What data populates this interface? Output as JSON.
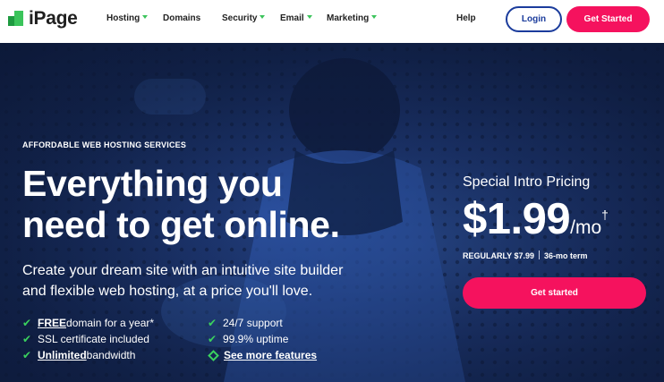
{
  "brand": {
    "name": "iPage",
    "accent": "#f5125e",
    "nav_blue": "#1b3c9c",
    "check_green": "#3bd15e"
  },
  "nav": {
    "items": [
      {
        "label": "Hosting",
        "dropdown": true
      },
      {
        "label": "Domains",
        "dropdown": false
      },
      {
        "label": "Security",
        "dropdown": true
      },
      {
        "label": "Email",
        "dropdown": true
      },
      {
        "label": "Marketing",
        "dropdown": true
      }
    ],
    "help": "Help",
    "login": "Login",
    "get_started": "Get Started"
  },
  "hero": {
    "kicker": "AFFORDABLE WEB HOSTING SERVICES",
    "headline_line1": "Everything you",
    "headline_line2": "need to get online.",
    "subhead_line1": "Create your dream site with an intuitive site builder",
    "subhead_line2": "and flexible web hosting, at a price you'll love.",
    "features": {
      "f1_bold": "FREE",
      "f1_rest": " domain for a year*",
      "f2": "SSL certificate included",
      "f3_bold": "Unlimited",
      "f3_rest": " bandwidth",
      "f4": "24/7 support",
      "f5": "99.9% uptime",
      "f6": "See more features"
    },
    "pricing": {
      "label": "Special Intro Pricing",
      "amount": "$1.99",
      "per": "/mo",
      "dagger": "†",
      "regular": "REGULARLY $7.99",
      "term": "36-mo term",
      "cta": "Get started"
    }
  }
}
